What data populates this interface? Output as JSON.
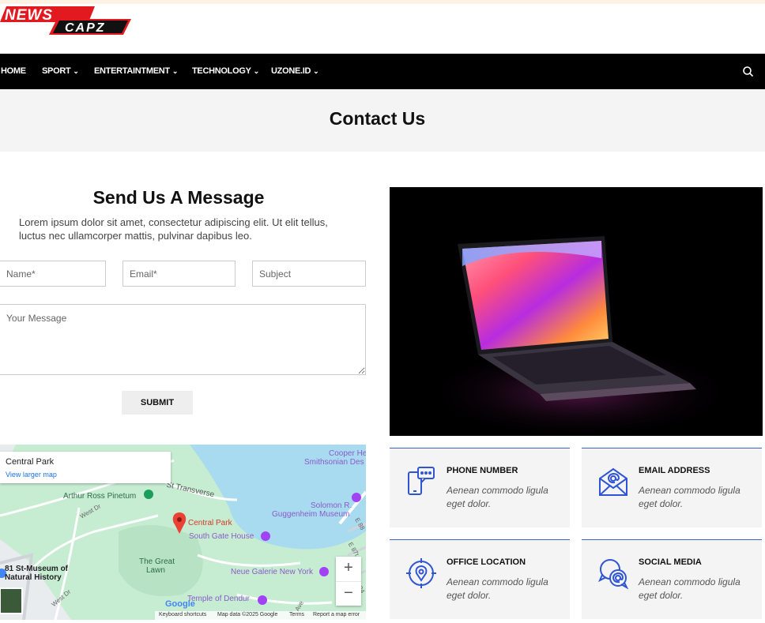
{
  "brand": {
    "logo_word1": "NEWS",
    "logo_word2": "CAPZ",
    "accent": "#e2191f"
  },
  "nav": {
    "items": [
      {
        "label": "HOME",
        "has_dropdown": false
      },
      {
        "label": "SPORT",
        "has_dropdown": true
      },
      {
        "label": "ENTERTAINTMENT",
        "has_dropdown": true
      },
      {
        "label": "TECHNOLOGY",
        "has_dropdown": true
      },
      {
        "label": "UZONE.ID",
        "has_dropdown": true
      }
    ],
    "search_icon": "search-icon"
  },
  "page": {
    "title": "Contact Us"
  },
  "form": {
    "title": "Send Us A Message",
    "description": "Lorem ipsum dolor sit amet, consectetur adipiscing elit. Ut elit tellus, luctus nec ullamcorper mattis, pulvinar dapibus leo.",
    "name_placeholder": "Name*",
    "email_placeholder": "Email*",
    "subject_placeholder": "Subject",
    "message_placeholder": "Your Message",
    "submit_label": "SUBMIT"
  },
  "map": {
    "place_title": "Central Park",
    "larger_map_link": "View larger map",
    "labels": {
      "cooper": "Cooper He",
      "smithsonian": "Smithsonian Des",
      "arthur": "Arthur Ross Pinetum",
      "transverse": "St Transverse",
      "solomon": "Solomon R.",
      "guggenheim": "Guggenheim Museum",
      "central_park": "Central Park",
      "south_gate": "South Gate House",
      "west_dr": "West Dr",
      "west_dr2": "West Dr",
      "great_lawn1": "The Great",
      "great_lawn2": "Lawn",
      "neue": "Neue Galerie New York",
      "museum1": "81 St-Museum of",
      "museum2": "Natural History",
      "temple": "Temple of Dendur",
      "e88": "E 88",
      "e87": "E 87t",
      "e84": "E 84",
      "ave": "Ave"
    },
    "zoom_in": "+",
    "zoom_out": "−",
    "google": "Google",
    "footer": {
      "shortcuts": "Keyboard shortcuts",
      "data": "Map data ©2025 Google",
      "terms": "Terms",
      "report": "Report a map error"
    }
  },
  "info_cards": [
    {
      "icon": "phone-chat-icon",
      "heading": "PHONE NUMBER",
      "text": "Aenean commodo ligula eget dolor."
    },
    {
      "icon": "email-envelope-icon",
      "heading": "EMAIL ADDRESS",
      "text": "Aenean commodo ligula eget dolor."
    },
    {
      "icon": "location-target-icon",
      "heading": "OFFICE LOCATION",
      "text": "Aenean commodo ligula eget dolor."
    },
    {
      "icon": "social-chat-icon",
      "heading": "SOCIAL MEDIA",
      "text": "Aenean commodo ligula eget dolor."
    }
  ],
  "colors": {
    "nav_bg": "#000000",
    "card_icon": "#2f55d4",
    "card_bg": "#f4f4f4"
  }
}
